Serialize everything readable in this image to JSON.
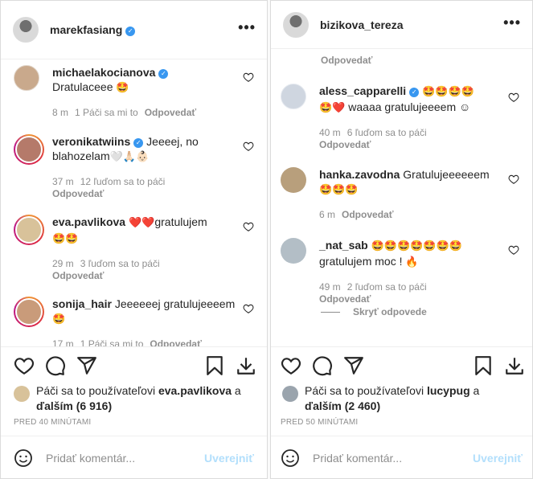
{
  "left": {
    "username": "marekfasiang",
    "verified": true,
    "comments": [
      {
        "user": "michaelakocianova",
        "verified": true,
        "text": "Dratulaceee",
        "emoji": "🤩",
        "time": "8 m",
        "likes": "1 Páči sa mi to",
        "reply": "Odpovedať",
        "avatar_color": "#c9a98c"
      },
      {
        "user": "veronikatwiins",
        "verified": true,
        "text": "Jeeeej, no blahozelam",
        "emoji": "🤍🙏🏻👶🏻",
        "time": "37 m",
        "likes": "12 ľuďom sa to páči",
        "reply": "Odpovedať",
        "avatar_color": "#b57a6a"
      },
      {
        "user": "eva.pavlikova",
        "verified": false,
        "text": "gratulujem",
        "emoji_pre": "❤️❤️",
        "emoji": "🤩🤩",
        "time": "29 m",
        "likes": "3 ľuďom sa to páči",
        "reply": "Odpovedať",
        "avatar_color": "#d8c29a"
      },
      {
        "user": "sonija_hair",
        "verified": false,
        "text": "Jeeeeeej gratulujeeeem",
        "emoji": "🤩",
        "time": "17 m",
        "likes": "1 Páči sa mi to",
        "reply": "Odpovedať",
        "avatar_color": "#c99b7a"
      }
    ],
    "liked_by_prefix": "Páči sa to používateľovi",
    "liked_by_user": "eva.pavlikova",
    "liked_by_suffix": "a",
    "liked_by_others": "ďalším (6 916)",
    "timestamp": "PRED 40 MINÚTAMI",
    "comment_placeholder": "Pridať komentár...",
    "post_label": "Uverejniť"
  },
  "right": {
    "username": "bizikova_tereza",
    "verified": false,
    "top_reply": "Odpovedať",
    "comments": [
      {
        "user": "aless_capparelli",
        "verified": true,
        "emoji_pre": "🤩🤩🤩🤩",
        "text": "waaaa gratulujeeeem ☺",
        "emoji_line2": "🤩❤️",
        "time": "40 m",
        "likes": "6 ľuďom sa to páči",
        "reply": "Odpovedať",
        "avatar_color": "#cfd6e0"
      },
      {
        "user": "hanka.zavodna",
        "verified": false,
        "text": "Gratulujeeeeeem",
        "emoji": "🤩🤩🤩",
        "time": "6 m",
        "likes": "",
        "reply": "Odpovedať",
        "avatar_color": "#b89f7c"
      },
      {
        "user": "_nat_sab",
        "verified": false,
        "emoji_pre": "🤩🤩🤩🤩🤩🤩🤩",
        "text": "gratulujem moc !",
        "emoji": "🔥",
        "time": "49 m",
        "likes": "2 ľuďom sa to páči",
        "reply": "Odpovedať",
        "avatar_color": "#b3bec6"
      }
    ],
    "hide_replies": "Skryť odpovede",
    "liked_by_prefix": "Páči sa to používateľovi",
    "liked_by_user": "lucypug",
    "liked_by_suffix": "a",
    "liked_by_others": "ďalším (2 460)",
    "timestamp": "PRED 50 MINÚTAMI",
    "comment_placeholder": "Pridať komentár...",
    "post_label": "Uverejniť"
  },
  "icons": {
    "like": "heart-icon",
    "comment": "comment-icon",
    "share": "paper-plane-icon",
    "save": "bookmark-icon",
    "download": "download-icon",
    "more": "more-options-icon",
    "emoji": "smiley-icon"
  },
  "colors": {
    "verified": "#3897f0",
    "heart_red": "#ed4956",
    "emoji_face": "#f5b301",
    "post_disabled": "#b2dffc",
    "secondary_text": "#8e8e8e",
    "border": "#dbdbdb"
  }
}
